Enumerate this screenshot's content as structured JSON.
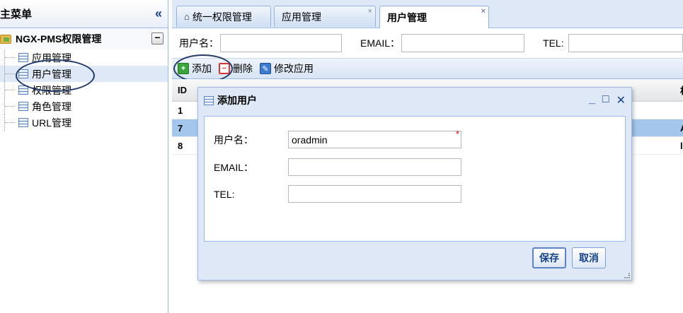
{
  "left": {
    "header_title": "主菜单",
    "collapse_icon": "«",
    "root_label": "NGX-PMS权限管理",
    "root_toggle": "−",
    "items": [
      {
        "label": "应用管理"
      },
      {
        "label": "用户管理"
      },
      {
        "label": "权限管理"
      },
      {
        "label": "角色管理"
      },
      {
        "label": "URL管理"
      }
    ]
  },
  "tabs": [
    {
      "label": "统一权限管理"
    },
    {
      "label": "应用管理"
    },
    {
      "label": "用户管理"
    }
  ],
  "tab_close": "×",
  "search": {
    "username_label": "用户名：",
    "email_label": "EMAIL：",
    "tel_label": "TEL:"
  },
  "toolbar": {
    "add_label": "添加",
    "delete_label": "删除",
    "edit_label": "修改应用"
  },
  "grid": {
    "header_id": "ID",
    "header_right": "相",
    "rows": [
      {
        "id": "1",
        "right": ""
      },
      {
        "id": "7",
        "right": "A"
      },
      {
        "id": "8",
        "right": "l"
      }
    ]
  },
  "dialog": {
    "title": "添加用户",
    "min_icon": "_",
    "max_icon": "□",
    "close_icon": "✕",
    "username_label": "用户名：",
    "username_value": "oradmin",
    "required_mark": "*",
    "email_label": "EMAIL：",
    "email_value": "",
    "tel_label": "TEL:",
    "tel_value": "",
    "save_label": "保存",
    "cancel_label": "取消"
  },
  "colors": {
    "panel_border": "#99bbe8",
    "header_bg": "#dfe8f6",
    "selected_row": "#a3c6ec",
    "annotation_circle": "#1f3a6b"
  }
}
